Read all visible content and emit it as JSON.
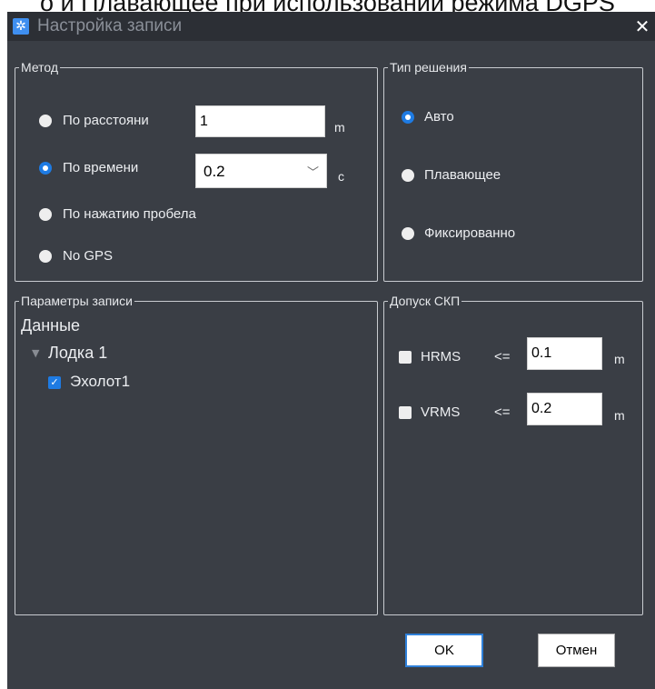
{
  "background_caption": "о и Плавающее при использовании режима DGPS",
  "dialog": {
    "title": "Настройка записи",
    "close_glyph": "✕",
    "app_icon": "gear-icon"
  },
  "method": {
    "legend": "Метод",
    "options": [
      {
        "label": "По расстояни",
        "selected": false
      },
      {
        "label": "По времени",
        "selected": true
      },
      {
        "label": "По нажатию пробела",
        "selected": false
      },
      {
        "label": "No GPS",
        "selected": false
      }
    ],
    "distance_value": "1",
    "distance_unit": "m",
    "time_value": "0.2",
    "time_unit": "c"
  },
  "solution_type": {
    "legend": "Тип решения",
    "options": [
      {
        "label": "Авто",
        "selected": true
      },
      {
        "label": "Плавающее",
        "selected": false
      },
      {
        "label": "Фиксированно",
        "selected": false
      }
    ]
  },
  "record_params": {
    "legend": "Параметры записи",
    "root": "Данные",
    "boat": "Лодка 1",
    "device": "Эхолот1",
    "device_checked": true
  },
  "tolerance": {
    "legend": "Допуск СКП",
    "hrms": {
      "label": "HRMS",
      "op": "<=",
      "value": "0.1",
      "unit": "m",
      "checked": false
    },
    "vrms": {
      "label": "VRMS",
      "op": "<=",
      "value": "0.2",
      "unit": "m",
      "checked": false
    }
  },
  "buttons": {
    "ok": "OK",
    "cancel": "Отмен"
  },
  "colors": {
    "window_bg": "#3a3e45",
    "accent": "#1e7be3",
    "titlebar_bg": "#2c2f35"
  }
}
